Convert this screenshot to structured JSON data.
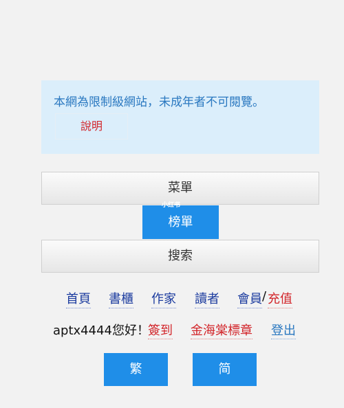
{
  "notice": {
    "text": "本網為限制級網站，未成年者不可閱覽。",
    "explain_label": "說明"
  },
  "menu": {
    "menu_label": "菜單",
    "ranking_label": "榜單",
    "search_label": "搜索",
    "watermark": "小红书"
  },
  "nav": {
    "home": "首頁",
    "bookshelf": "書櫃",
    "author": "作家",
    "reader": "讀者",
    "member": "會員",
    "separator": "/",
    "recharge": "充值"
  },
  "user": {
    "greeting": "aptx4444您好！",
    "signin": "簽到",
    "badge": "金海棠標章",
    "logout": "登出"
  },
  "lang": {
    "traditional": "繁",
    "simplified": "简"
  }
}
